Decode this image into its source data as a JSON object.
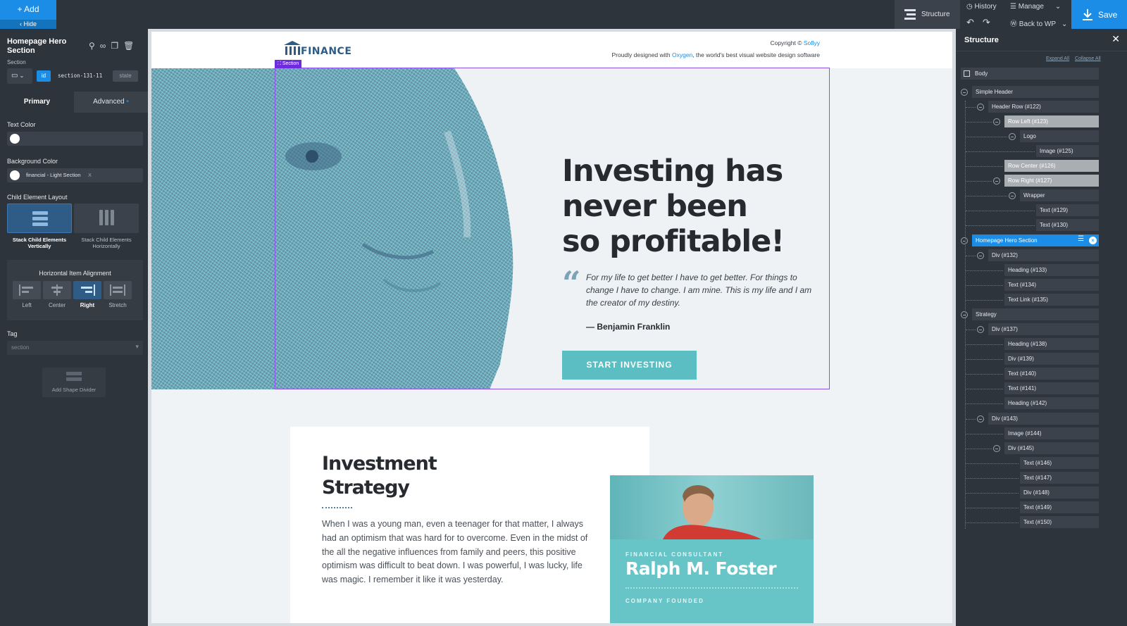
{
  "topbar": {
    "add_label": "Add",
    "hide_label": "Hide",
    "structure_label": "Structure",
    "history_label": "History",
    "manage_label": "Manage",
    "back_label": "Back to WP",
    "save_label": "Save"
  },
  "left_panel": {
    "title": "Homepage Hero Section",
    "subtitle": "Section",
    "id_badge": "id",
    "id_value": "section-131-11",
    "state_label": "state",
    "tab_primary": "Primary",
    "tab_advanced": "Advanced",
    "text_color_label": "Text Color",
    "bg_color_label": "Background Color",
    "bg_color_value": "financial - Light Section",
    "bg_color_clear": "X",
    "child_layout_label": "Child Element Layout",
    "layout_vertical": "Stack Child Elements Vertically",
    "layout_horizontal": "Stack Child Elements Horizontally",
    "h_align_label": "Horizontal Item Alignment",
    "align_left": "Left",
    "align_center": "Center",
    "align_right": "Right",
    "align_stretch": "Stretch",
    "tag_label": "Tag",
    "tag_value": "section",
    "shape_divider_label": "Add Shape Divider"
  },
  "page": {
    "logo_text": "FINANCE",
    "copyright_prefix": "Copyright ©",
    "copyright_link": "Soflyy",
    "designed_prefix": "Proudly designed with",
    "designed_link": "Oxygen",
    "designed_suffix": ", the world's best visual website design software",
    "section_tag": "Section",
    "hero_heading_1": "Investing has",
    "hero_heading_2": "never been",
    "hero_heading_3": "so profitable!",
    "hero_quote": "For my life to get better I have to get better. For things to change I have to change. I am mine. This is my life and I am the creator of my destiny.",
    "hero_author": "— Benjamin Franklin",
    "hero_cta": "START INVESTING",
    "strategy_title_1": "Investment",
    "strategy_title_2": "Strategy",
    "strategy_body": "When I was a young man, even a teenager for that matter, I always had an optimism that was hard for to overcome. Even in the midst of the all the negative influences from family and peers, this positive optimism was difficult to beat down. I was powerful, I was lucky, life was magic. I remember it like it was yesterday.",
    "profile_role": "FINANCIAL CONSULTANT",
    "profile_name": "Ralph M. Foster",
    "profile_founded": "COMPANY FOUNDED"
  },
  "structure_panel": {
    "title": "Structure",
    "expand_all": "Expand All",
    "collapse_all": "Collapse All",
    "items": [
      {
        "label": "Body"
      },
      {
        "label": "Simple Header"
      },
      {
        "label": "Header Row (#122)"
      },
      {
        "label": "Row Left (#123)"
      },
      {
        "label": "Logo"
      },
      {
        "label": "Image (#125)"
      },
      {
        "label": "Row Center (#126)"
      },
      {
        "label": "Row Right (#127)"
      },
      {
        "label": "Wrapper"
      },
      {
        "label": "Text (#129)"
      },
      {
        "label": "Text (#130)"
      },
      {
        "label": "Homepage Hero Section"
      },
      {
        "label": "Div (#132)"
      },
      {
        "label": "Heading (#133)"
      },
      {
        "label": "Text (#134)"
      },
      {
        "label": "Text Link (#135)"
      },
      {
        "label": "Strategy"
      },
      {
        "label": "Div (#137)"
      },
      {
        "label": "Heading (#138)"
      },
      {
        "label": "Div (#139)"
      },
      {
        "label": "Text (#140)"
      },
      {
        "label": "Text (#141)"
      },
      {
        "label": "Heading (#142)"
      },
      {
        "label": "Div (#143)"
      },
      {
        "label": "Image (#144)"
      },
      {
        "label": "Div (#145)"
      },
      {
        "label": "Text (#146)"
      },
      {
        "label": "Text (#147)"
      },
      {
        "label": "Div (#148)"
      },
      {
        "label": "Text (#149)"
      },
      {
        "label": "Text (#150)"
      }
    ]
  },
  "colors": {
    "accent": "#1b8de6",
    "teal": "#5bbec2",
    "selection": "#8a52e6"
  }
}
